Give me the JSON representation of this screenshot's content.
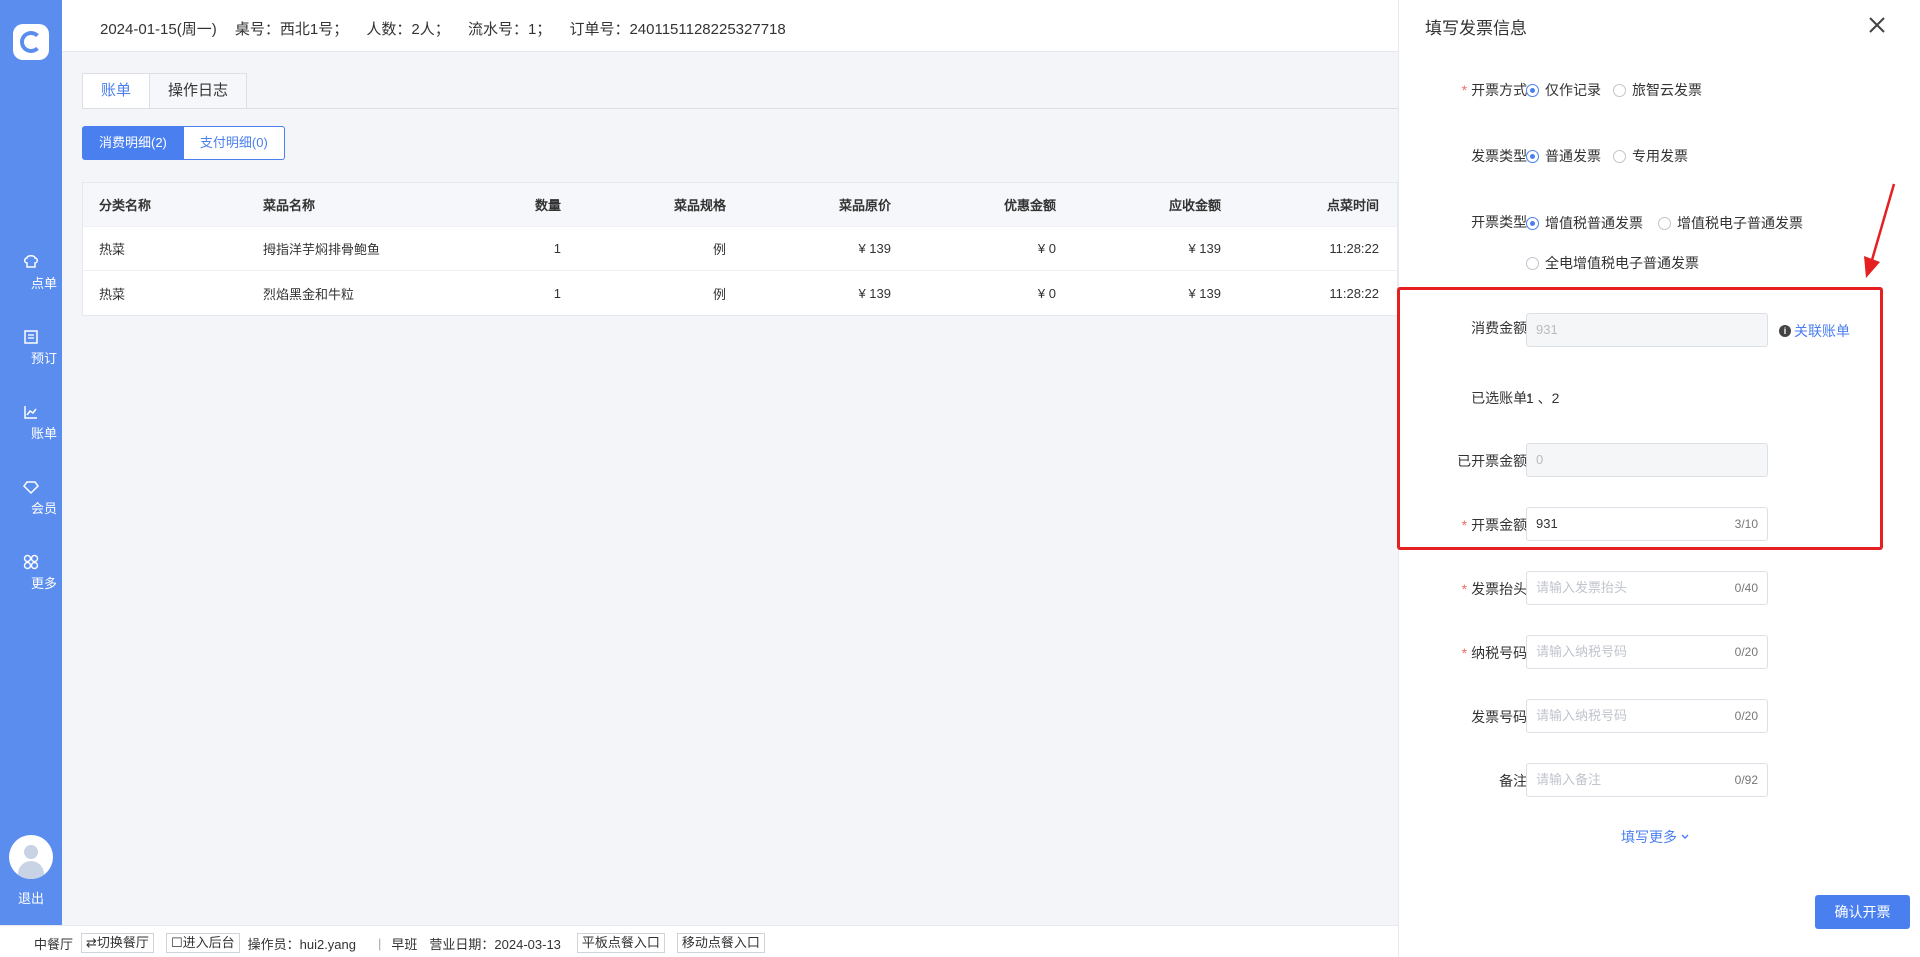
{
  "sidebar": {
    "items": [
      {
        "label": "点单",
        "icon": "chef-hat-icon"
      },
      {
        "label": "预订",
        "icon": "reservation-icon"
      },
      {
        "label": "账单",
        "icon": "chart-icon"
      },
      {
        "label": "会员",
        "icon": "diamond-icon"
      },
      {
        "label": "更多",
        "icon": "grid-icon"
      }
    ],
    "logout": "退出"
  },
  "header": {
    "date": "2024-01-15(周一)",
    "table": "桌号：西北1号；",
    "people": "人数：2人；",
    "serial": "流水号：1；",
    "order": "订单号：2401151128225327718"
  },
  "tabs": [
    "账单",
    "操作日志"
  ],
  "segments": [
    "消费明细(2)",
    "支付明细(0)"
  ],
  "table": {
    "headers": [
      "分类名称",
      "菜品名称",
      "数量",
      "菜品规格",
      "菜品原价",
      "优惠金额",
      "应收金额",
      "点菜时间"
    ],
    "rows": [
      [
        "热菜",
        "拇指洋芋焖排骨鲍鱼",
        "1",
        "例",
        "¥ 139",
        "¥ 0",
        "¥ 139",
        "11:28:22"
      ],
      [
        "热菜",
        "烈焰黑金和牛粒",
        "1",
        "例",
        "¥ 139",
        "¥ 0",
        "¥ 139",
        "11:28:22"
      ]
    ]
  },
  "status": {
    "hall": "中餐厅",
    "switch": "切换餐厅",
    "backend": "进入后台",
    "operator": "操作员：hui2.yang",
    "shift": "早班",
    "biz_date": "营业日期：2024-03-13",
    "tablet": "平板点餐入口",
    "mobile": "移动点餐入口"
  },
  "drawer": {
    "title": "填写发票信息",
    "method_label": "开票方式:",
    "method_options": [
      "仅作记录",
      "旅智云发票"
    ],
    "type_label": "发票类型:",
    "type_options": [
      "普通发票",
      "专用发票"
    ],
    "kind_label": "开票类型:",
    "kind_options": [
      "增值税普通发票",
      "增值税电子普通发票",
      "全电增值税电子普通发票"
    ],
    "consume_label": "消费金额:",
    "consume_value": "931",
    "related_link": "关联账单",
    "selected_label": "已选账单:",
    "selected_value": "1 、2",
    "issued_label": "已开票金额:",
    "issued_value": "0",
    "amount_label": "开票金额:",
    "amount_value": "931",
    "amount_count": "3/10",
    "header_label": "发票抬头:",
    "header_placeholder": "请输入发票抬头",
    "header_count": "0/40",
    "tax_label": "纳税号码:",
    "tax_placeholder": "请输入纳税号码",
    "tax_count": "0/20",
    "invoice_no_label": "发票号码:",
    "invoice_no_placeholder": "请输入纳税号码",
    "invoice_no_count": "0/20",
    "remark_label": "备注:",
    "remark_placeholder": "请输入备注",
    "remark_count": "0/92",
    "more_link": "填写更多",
    "confirm": "确认开票"
  },
  "colors": {
    "sidebar": "#5b8def",
    "accent": "#4a7ff0",
    "highlight": "#e62020",
    "required": "#f56c6c"
  }
}
